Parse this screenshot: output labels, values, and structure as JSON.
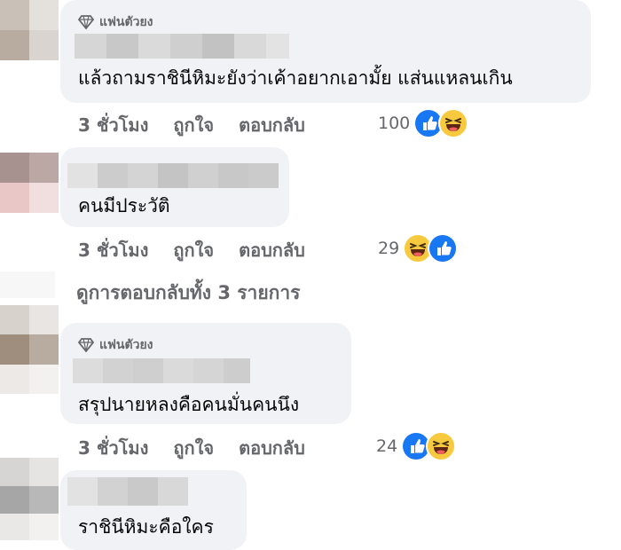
{
  "comments": [
    {
      "badge": "แฟนตัวยง",
      "text": "แล้วถามราชินีหิมะยังว่าเค้าอยากเอามั้ย แส่นแหลนเกิน",
      "time": "3 ชั่วโมง",
      "like_label": "ถูกใจ",
      "reply_label": "ตอบกลับ",
      "reaction_count": "100",
      "reaction_icons": [
        "like-icon",
        "haha-icon"
      ]
    },
    {
      "badge": "",
      "text": "คนมีประวัติ",
      "time": "3 ชั่วโมง",
      "like_label": "ถูกใจ",
      "reply_label": "ตอบกลับ",
      "reaction_count": "29",
      "reaction_icons": [
        "haha-icon",
        "like-icon"
      ]
    },
    {
      "badge": "แฟนตัวยง",
      "text": "สรุปนายหลงคือคนมั่นคนนึง",
      "time": "3 ชั่วโมง",
      "like_label": "ถูกใจ",
      "reply_label": "ตอบกลับ",
      "reaction_count": "24",
      "reaction_icons": [
        "like-icon",
        "haha-icon"
      ]
    },
    {
      "badge": "",
      "text": "ราชินีหิมะคือใคร"
    }
  ],
  "view_replies": "ดูการตอบกลับทั้ง 3 รายการ",
  "colors": {
    "bubble": "#f0f2f5",
    "secondary_text": "#65676b",
    "like_blue": "#1877f2",
    "haha_yellow": "#f7c93e"
  }
}
